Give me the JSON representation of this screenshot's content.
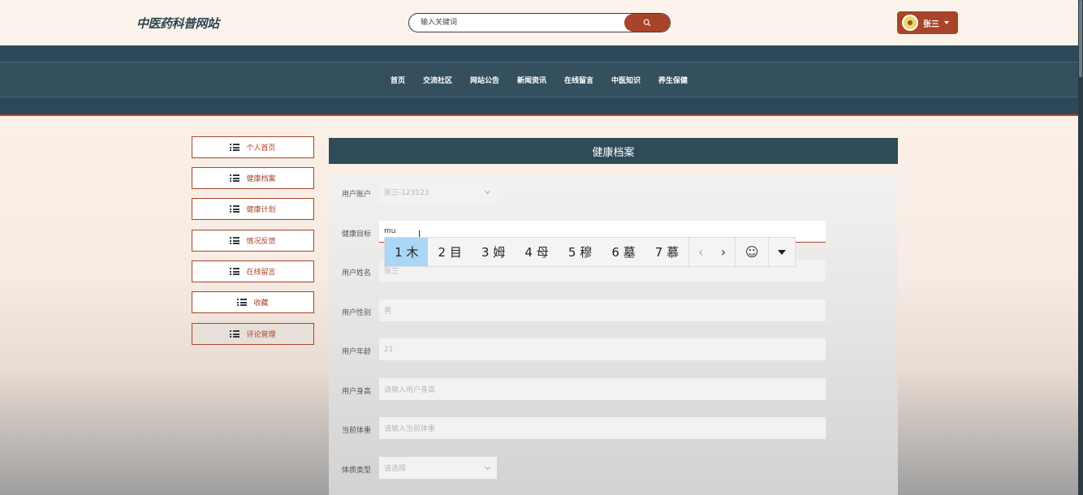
{
  "header": {
    "logo": "中医药科普网站",
    "search_placeholder": "输入关键词",
    "user_name": "张三"
  },
  "nav": [
    "首页",
    "交流社区",
    "网站公告",
    "新闻资讯",
    "在线留言",
    "中医知识",
    "养生保健"
  ],
  "sidebar": [
    "个人首页",
    "健康档案",
    "健康计划",
    "情况反馈",
    "在线留言",
    "收藏",
    "评论管理"
  ],
  "panel_title": "健康档案",
  "form": {
    "account_label": "用户账户",
    "account_value": "张三-123123",
    "goal_label": "健康目标",
    "goal_value": "mu",
    "name_label": "用户姓名",
    "name_value": "张三",
    "gender_label": "用户性别",
    "gender_value": "男",
    "age_label": "用户年龄",
    "age_value": "21",
    "height_label": "用户身高",
    "height_placeholder": "请输入用户身高",
    "weight_label": "当前体重",
    "weight_placeholder": "请输入当前体重",
    "constitution_label": "体质类型",
    "constitution_placeholder": "请选择"
  },
  "ime_candidates": [
    "1 木",
    "2 目",
    "3 姆",
    "4 母",
    "5 穆",
    "6 墓",
    "7 慕"
  ]
}
